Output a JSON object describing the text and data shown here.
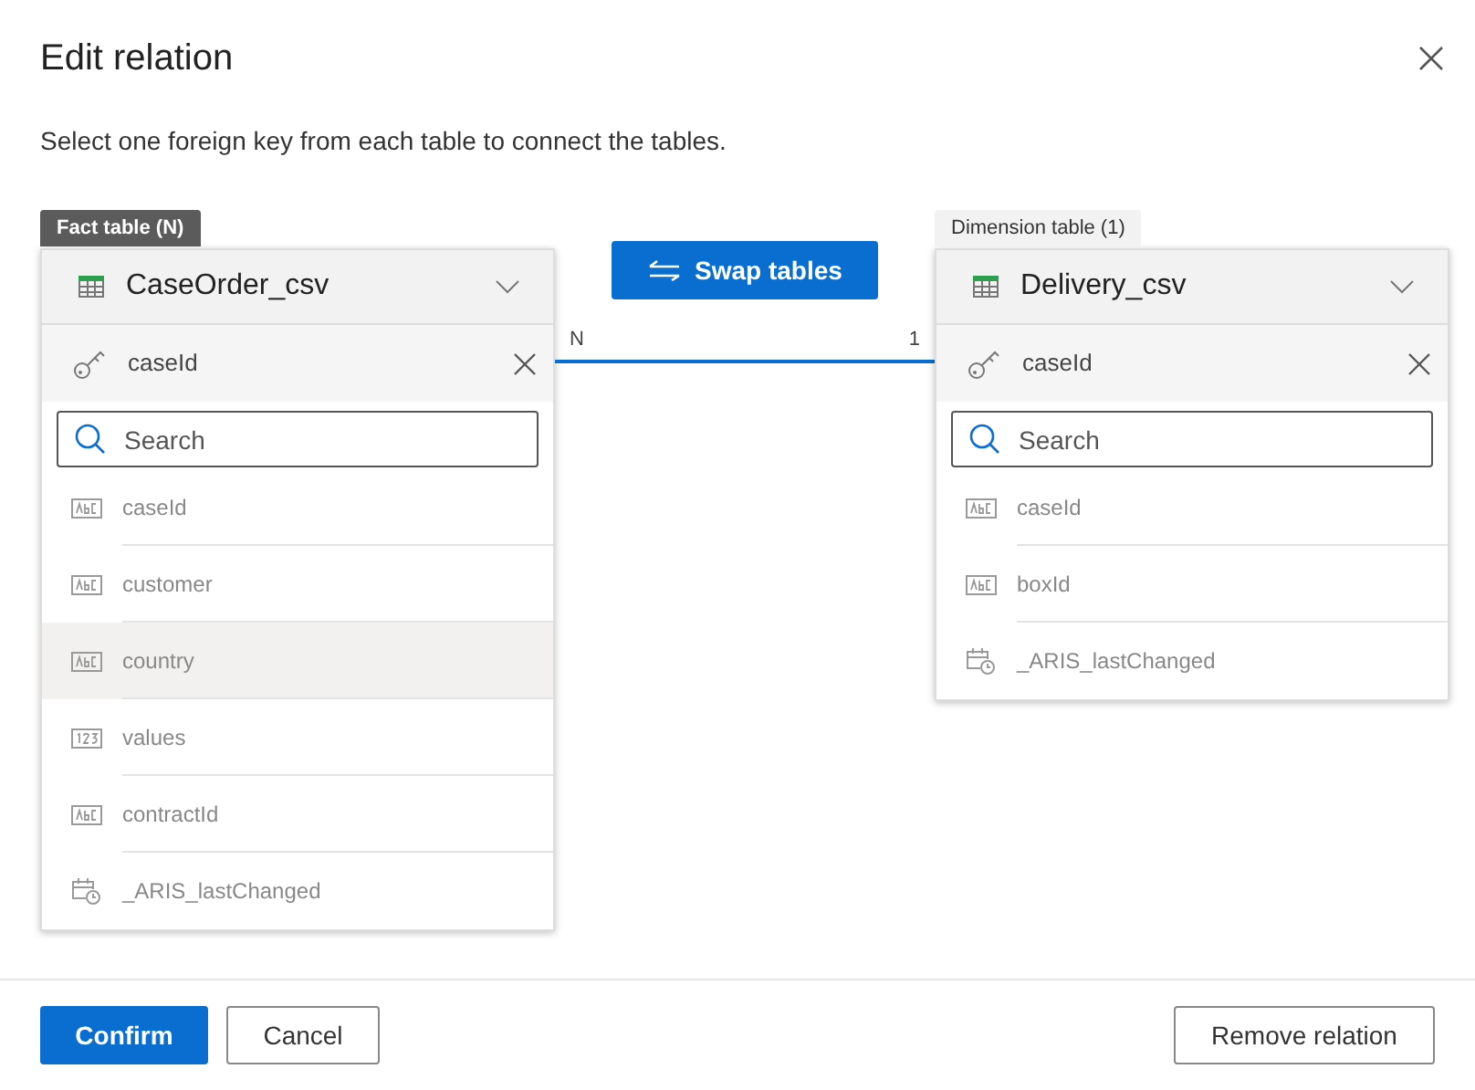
{
  "dialog": {
    "title": "Edit relation",
    "description": "Select one foreign key from each table to connect the tables."
  },
  "tables": [
    {
      "label": "Fact table (N)",
      "selected": true,
      "name": "CaseOrder_csv",
      "key": "caseId",
      "search": {
        "placeholder": "Search"
      },
      "fields": [
        {
          "name": "caseId",
          "kind": "text",
          "selected": false
        },
        {
          "name": "customer",
          "kind": "text",
          "selected": false
        },
        {
          "name": "country",
          "kind": "text",
          "selected": true
        },
        {
          "name": "values",
          "kind": "number",
          "selected": false
        },
        {
          "name": "contractId",
          "kind": "text",
          "selected": false
        },
        {
          "name": "_ARIS_lastChanged",
          "kind": "date",
          "selected": false
        }
      ]
    },
    {
      "label": "Dimension table (1)",
      "selected": false,
      "name": "Delivery_csv",
      "key": "caseId",
      "search": {
        "placeholder": "Search"
      },
      "fields": [
        {
          "name": "caseId",
          "kind": "text",
          "selected": false
        },
        {
          "name": "boxId",
          "kind": "text",
          "selected": false
        },
        {
          "name": "_ARIS_lastChanged",
          "kind": "date",
          "selected": false
        }
      ]
    }
  ],
  "swap_button": "Swap tables",
  "connector": {
    "left_label": "N",
    "right_label": "1"
  },
  "footer": {
    "confirm": "Confirm",
    "cancel": "Cancel",
    "remove": "Remove relation"
  }
}
